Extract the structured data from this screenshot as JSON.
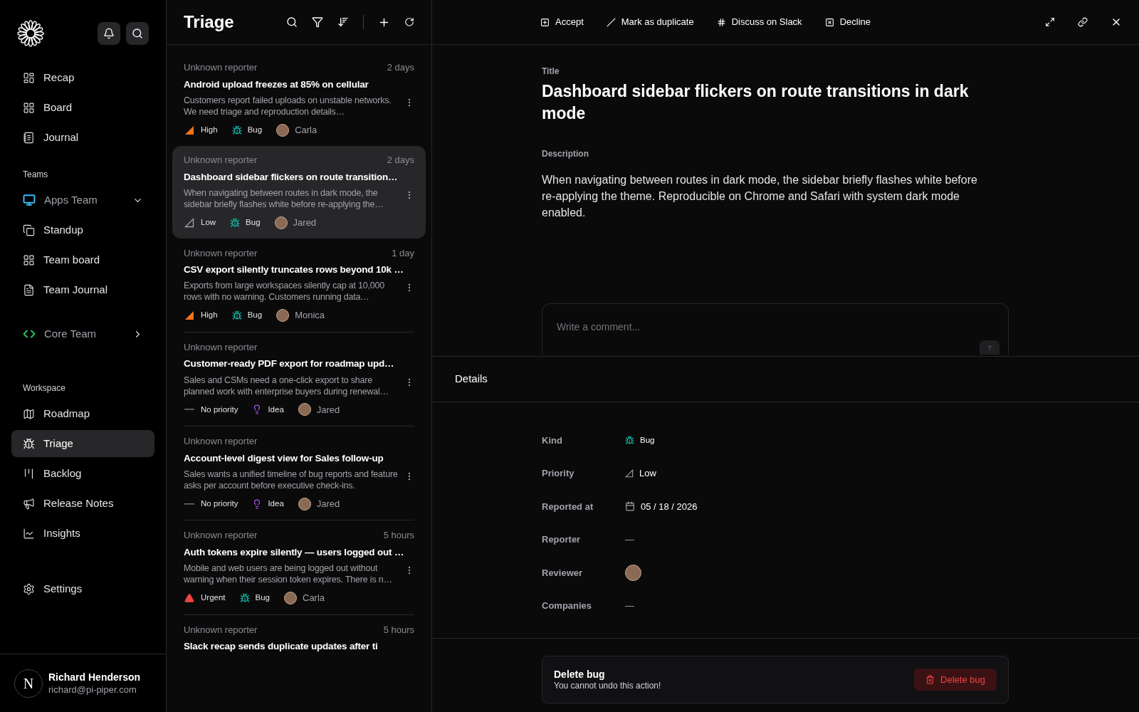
{
  "sidebar": {
    "main_items": [
      {
        "label": "Recap",
        "selected": false
      },
      {
        "label": "Board",
        "selected": false
      },
      {
        "label": "Journal",
        "selected": false
      }
    ],
    "teams_heading": "Teams",
    "teams": [
      {
        "label": "Apps Team",
        "color": "#38bdf8",
        "expanded": true,
        "children": [
          {
            "label": "Standup",
            "selected": false
          },
          {
            "label": "Team board",
            "selected": false
          },
          {
            "label": "Team Journal",
            "selected": false
          }
        ]
      },
      {
        "label": "Core Team",
        "color": "#22c55e",
        "expanded": false
      }
    ],
    "workspace_heading": "Workspace",
    "workspace_items": [
      {
        "label": "Roadmap",
        "selected": false
      },
      {
        "label": "Triage",
        "selected": true
      },
      {
        "label": "Backlog",
        "selected": false
      },
      {
        "label": "Release Notes",
        "selected": false
      },
      {
        "label": "Insights",
        "selected": false
      }
    ],
    "settings": {
      "label": "Settings",
      "selected": false
    },
    "user": {
      "initial": "N",
      "name": "Richard Henderson",
      "email": "richard@pi-piper.com"
    }
  },
  "list": {
    "title": "Triage",
    "items": [
      {
        "reporter": "Unknown reporter",
        "age": "2 days",
        "title": "Android upload freezes at 85% on cellular",
        "summary": "Customers report failed uploads on unstable networks. We need triage and reproduction details…",
        "priority": {
          "kind": "high",
          "label": "High"
        },
        "type": {
          "kind": "bug",
          "label": "Bug"
        },
        "assignee": "Carla",
        "selected": false
      },
      {
        "reporter": "Unknown reporter",
        "age": "2 days",
        "title": "Dashboard sidebar flickers on route transition…",
        "summary": "When navigating between routes in dark mode, the sidebar briefly flashes white before re-applying the…",
        "priority": {
          "kind": "low",
          "label": "Low"
        },
        "type": {
          "kind": "bug",
          "label": "Bug"
        },
        "assignee": "Jared",
        "selected": true
      },
      {
        "reporter": "Unknown reporter",
        "age": "1 day",
        "title": "CSV export silently truncates rows beyond 10k …",
        "summary": "Exports from large workspaces silently cap at 10,000 rows with no warning. Customers running data…",
        "priority": {
          "kind": "high",
          "label": "High"
        },
        "type": {
          "kind": "bug",
          "label": "Bug"
        },
        "assignee": "Monica",
        "selected": false
      },
      {
        "reporter": "Unknown reporter",
        "title": "Customer-ready PDF export for roadmap upd…",
        "summary": "Sales and CSMs need a one-click export to share planned work with enterprise buyers during renewal…",
        "priority": {
          "kind": "none",
          "label": "No priority"
        },
        "type": {
          "kind": "idea",
          "label": "Idea"
        },
        "assignee": "Jared",
        "selected": false
      },
      {
        "reporter": "Unknown reporter",
        "title": "Account-level digest view for Sales follow-up",
        "summary": "Sales wants a unified timeline of bug reports and feature asks per account before executive check-ins.",
        "priority": {
          "kind": "none",
          "label": "No priority"
        },
        "type": {
          "kind": "idea",
          "label": "Idea"
        },
        "assignee": "Jared",
        "selected": false
      },
      {
        "reporter": "Unknown reporter",
        "age": "5 hours",
        "title": "Auth tokens expire silently — users logged out …",
        "summary": "Mobile and web users are being logged out without warning when their session token expires. There is n…",
        "priority": {
          "kind": "urgent",
          "label": "Urgent"
        },
        "type": {
          "kind": "bug",
          "label": "Bug"
        },
        "assignee": "Carla",
        "selected": false
      },
      {
        "reporter": "Unknown reporter",
        "age": "5 hours",
        "title": "Slack recap sends duplicate updates after ti",
        "selected": false
      }
    ]
  },
  "detail": {
    "actions": [
      "Accept",
      "Mark as duplicate",
      "Discuss on Slack",
      "Decline"
    ],
    "title_label": "Title",
    "title": "Dashboard sidebar flickers on route transitions in dark mode",
    "description_label": "Description",
    "description": "When navigating between routes in dark mode, the sidebar briefly flashes white before re-applying the theme. Reproducible on Chrome and Safari with system dark mode enabled.",
    "comment": {
      "placeholder": "Write a comment..."
    },
    "details_heading": "Details",
    "rows": [
      {
        "label": "Kind",
        "kind": "type",
        "value": "Bug"
      },
      {
        "label": "Priority",
        "kind": "priority",
        "value": "Low"
      },
      {
        "label": "Reported at",
        "kind": "date",
        "value": "05 / 18 / 2026"
      },
      {
        "label": "Reporter",
        "kind": "text",
        "value": "—"
      },
      {
        "label": "Reviewer",
        "kind": "avatar"
      },
      {
        "label": "Companies",
        "kind": "text",
        "value": "—"
      }
    ],
    "danger": {
      "title": "Delete bug",
      "note": "You cannot undo this action!",
      "button": "Delete bug"
    }
  }
}
